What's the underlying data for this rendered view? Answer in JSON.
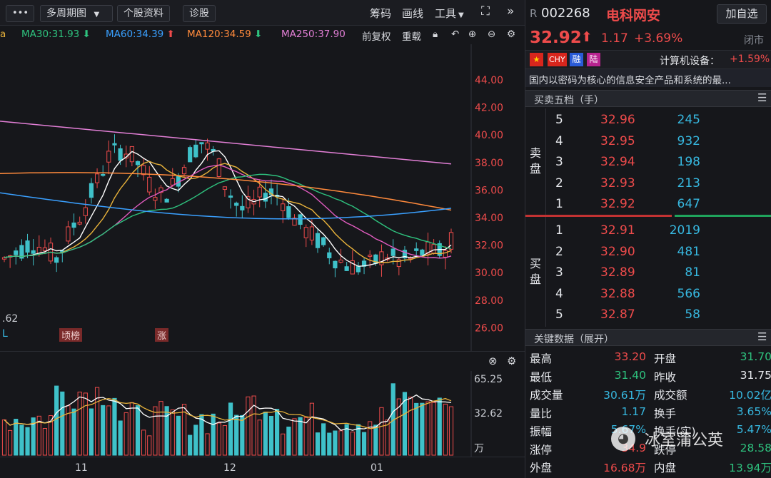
{
  "toolbar": {
    "more_label": "•••",
    "multi_period_label": "多周期图",
    "stock_info_label": "个股资料",
    "diagnose_label": "诊股",
    "chips_label": "筹码",
    "draw_label": "画线",
    "tools_label": "工具"
  },
  "ma_bar": {
    "ma30": "MA30:31.93",
    "ma60": "MA60:34.39",
    "ma120": "MA120:34.59",
    "ma250": "MA250:37.90",
    "adjust_label": "前复权",
    "overlay_label": "重载",
    "colors": {
      "ma30": "#2ec27e",
      "ma60": "#3aa0ff",
      "ma120": "#ff8a3c",
      "ma250": "#e27fd6"
    }
  },
  "price_axis": [
    "44.00",
    "42.00",
    "40.00",
    "38.00",
    "36.00",
    "34.00",
    "32.00",
    "30.00",
    "28.00",
    "26.00"
  ],
  "chart_marks": {
    "low_label": ".62",
    "flag_l": "L",
    "flag_bang": "顷榜",
    "flag_zhang": "涨"
  },
  "volume_axis": {
    "top": "65.25",
    "mid": "32.62",
    "unit": "万"
  },
  "x_axis": {
    "m11": "11",
    "m12": "12",
    "m01": "01"
  },
  "stock": {
    "badge": "R",
    "code": "002268",
    "name": "电科网安",
    "add_fav_label": "加自选",
    "price": "32.92",
    "change": "1.17",
    "change_pct": "+3.69%",
    "market_state": "闭市",
    "tags": [
      "CHY",
      "融",
      "陆"
    ],
    "sector": "计算机设备：",
    "sector_pct": "+1.59%",
    "desc": "国内以密码为核心的信息安全产品和系统的最..."
  },
  "orderbook": {
    "title": "买卖五档（手）",
    "sell_label": [
      "卖",
      "盘"
    ],
    "buy_label": [
      "买",
      "盘"
    ],
    "asks": [
      {
        "lvl": "5",
        "price": "32.96",
        "vol": "245"
      },
      {
        "lvl": "4",
        "price": "32.95",
        "vol": "932"
      },
      {
        "lvl": "3",
        "price": "32.94",
        "vol": "198"
      },
      {
        "lvl": "2",
        "price": "32.93",
        "vol": "213"
      },
      {
        "lvl": "1",
        "price": "32.92",
        "vol": "647"
      }
    ],
    "bids": [
      {
        "lvl": "1",
        "price": "32.91",
        "vol": "2019"
      },
      {
        "lvl": "2",
        "price": "32.90",
        "vol": "481"
      },
      {
        "lvl": "3",
        "price": "32.89",
        "vol": "81"
      },
      {
        "lvl": "4",
        "price": "32.88",
        "vol": "566"
      },
      {
        "lvl": "5",
        "price": "32.87",
        "vol": "58"
      }
    ]
  },
  "keydata": {
    "title": "关键数据（展开）",
    "rows": [
      {
        "l1": "最高",
        "v1": "33.20",
        "l2": "开盘",
        "v2": "31.70"
      },
      {
        "l1": "最低",
        "v1": "31.40",
        "l2": "昨收",
        "v2": "31.75"
      },
      {
        "l1": "成交量",
        "v1": "30.61万",
        "l2": "成交额",
        "v2": "10.02亿"
      },
      {
        "l1": "量比",
        "v1": "1.17",
        "l2": "换手",
        "v2": "3.65%"
      },
      {
        "l1": "振幅",
        "v1": "5.67%",
        "l2": "换手(实)",
        "v2": "5.47%"
      },
      {
        "l1": "涨停",
        "v1": "34.9",
        "l2": "跌停",
        "v2": "28.58"
      },
      {
        "l1": "外盘",
        "v1": "16.68万",
        "l2": "内盘",
        "v2": "13.94万"
      }
    ]
  },
  "watermark": "冰室蒲公英"
}
